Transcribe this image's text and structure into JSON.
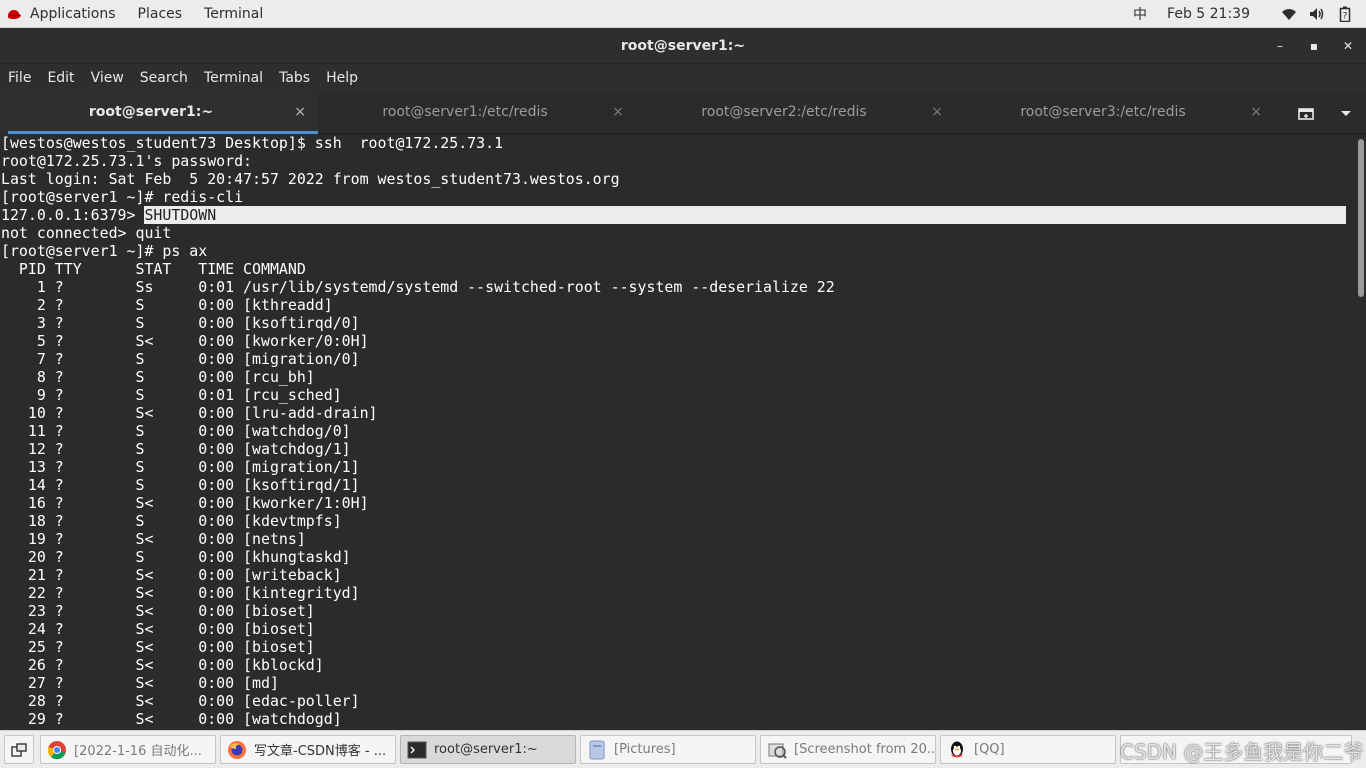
{
  "topbar": {
    "applications": "Applications",
    "places": "Places",
    "terminal": "Terminal",
    "ime": "中",
    "clock": "Feb 5  21:39",
    "icons": [
      "wifi-icon",
      "volume-icon",
      "battery-icon"
    ]
  },
  "window": {
    "title": "root@server1:~",
    "minimize": "–",
    "maximize": "▪",
    "close": "✕"
  },
  "menubar": [
    "File",
    "Edit",
    "View",
    "Search",
    "Terminal",
    "Tabs",
    "Help"
  ],
  "tabs": [
    {
      "label": "root@server1:~",
      "active": true
    },
    {
      "label": "root@server1:/etc/redis",
      "active": false
    },
    {
      "label": "root@server2:/etc/redis",
      "active": false
    },
    {
      "label": "root@server3:/etc/redis",
      "active": false
    }
  ],
  "tab_close": "×",
  "terminal": {
    "before": [
      "[westos@westos_student73 Desktop]$ ssh  root@172.25.73.1",
      "root@172.25.73.1's password: ",
      "Last login: Sat Feb  5 20:47:57 2022 from westos_student73.westos.org",
      "[root@server1 ~]# redis-cli"
    ],
    "prompt": "127.0.0.1:6379> ",
    "highlighted": "SHUTDOWN",
    "after": [
      "not connected> quit",
      "[root@server1 ~]# ps ax",
      "  PID TTY      STAT   TIME COMMAND",
      "    1 ?        Ss     0:01 /usr/lib/systemd/systemd --switched-root --system --deserialize 22",
      "    2 ?        S      0:00 [kthreadd]",
      "    3 ?        S      0:00 [ksoftirqd/0]",
      "    5 ?        S<     0:00 [kworker/0:0H]",
      "    7 ?        S      0:00 [migration/0]",
      "    8 ?        S      0:00 [rcu_bh]",
      "    9 ?        S      0:01 [rcu_sched]",
      "   10 ?        S<     0:00 [lru-add-drain]",
      "   11 ?        S      0:00 [watchdog/0]",
      "   12 ?        S      0:00 [watchdog/1]",
      "   13 ?        S      0:00 [migration/1]",
      "   14 ?        S      0:00 [ksoftirqd/1]",
      "   16 ?        S<     0:00 [kworker/1:0H]",
      "   18 ?        S      0:00 [kdevtmpfs]",
      "   19 ?        S<     0:00 [netns]",
      "   20 ?        S      0:00 [khungtaskd]",
      "   21 ?        S<     0:00 [writeback]",
      "   22 ?        S<     0:00 [kintegrityd]",
      "   23 ?        S<     0:00 [bioset]",
      "   24 ?        S<     0:00 [bioset]",
      "   25 ?        S<     0:00 [bioset]",
      "   26 ?        S<     0:00 [kblockd]",
      "   27 ?        S<     0:00 [md]",
      "   28 ?        S<     0:00 [edac-poller]",
      "   29 ?        S<     0:00 [watchdogd]"
    ]
  },
  "taskbar": {
    "items": [
      {
        "label": "[2022-1-16 自动化...",
        "icon": "chrome-icon",
        "active": false
      },
      {
        "label": "写文章-CSDN博客 - ...",
        "icon": "firefox-icon",
        "active": false
      },
      {
        "label": "root@server1:~",
        "icon": "terminal-icon",
        "active": true
      },
      {
        "label": "[Pictures]",
        "icon": "file-manager-icon",
        "active": false
      },
      {
        "label": "[Screenshot from 20...",
        "icon": "screenshot-icon",
        "active": false
      },
      {
        "label": "[QQ]",
        "icon": "qq-icon",
        "active": false
      }
    ]
  },
  "watermark": "CSDN @王多鱼我是你二爷",
  "colors": {
    "terminal_bg": "#2b2b2b",
    "terminal_fg": "#ffffff",
    "accent": "#4a90d9",
    "panel": "#ececec"
  }
}
